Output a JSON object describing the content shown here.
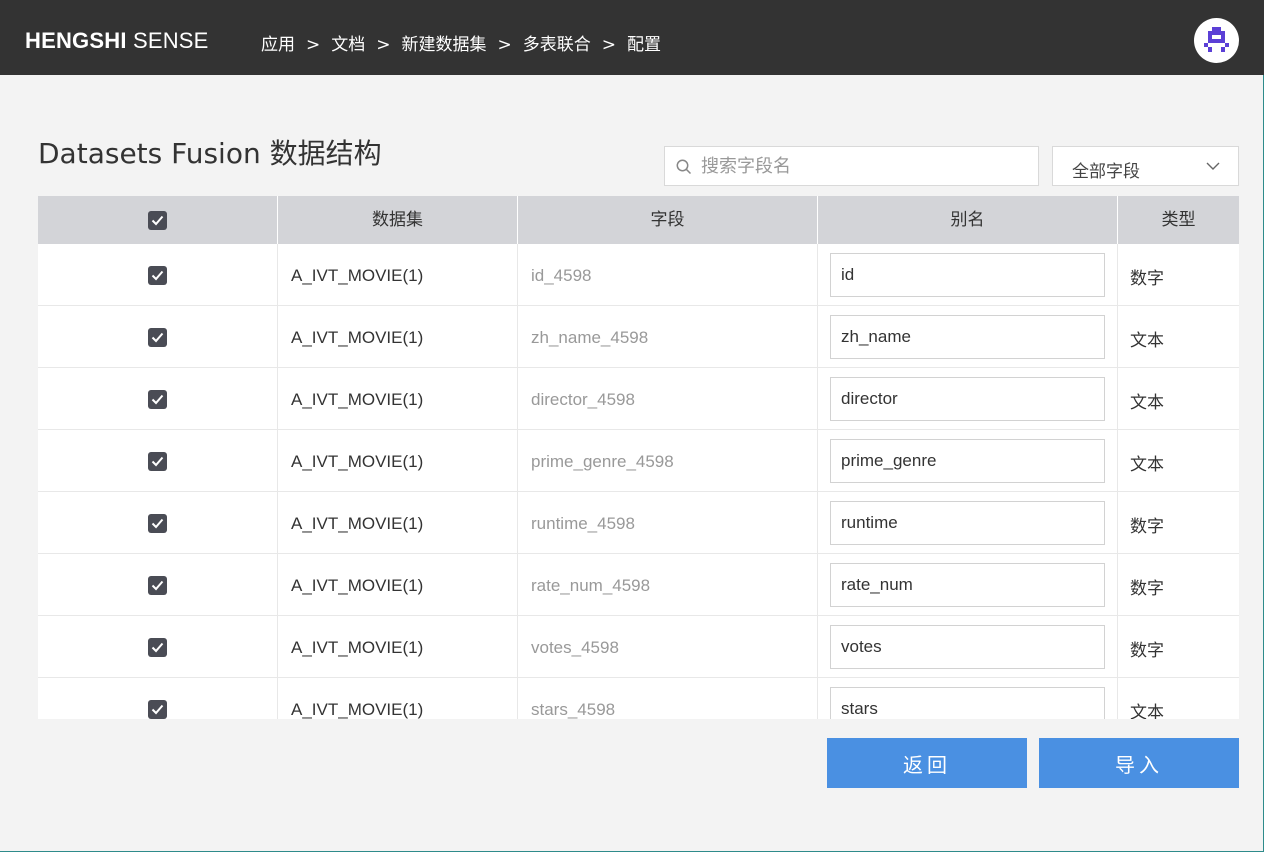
{
  "header": {
    "brand_bold": "HENGSHI",
    "brand_light": " SENSE",
    "breadcrumb": [
      "应用",
      "文档",
      "新建数据集",
      "多表联合",
      "配置"
    ],
    "separator": ">"
  },
  "page": {
    "title": "Datasets Fusion 数据结构"
  },
  "search": {
    "placeholder": "搜索字段名",
    "value": ""
  },
  "filter": {
    "selected": "全部字段"
  },
  "table": {
    "columns": [
      "数据集",
      "字段",
      "别名",
      "类型"
    ],
    "rows": [
      {
        "dataset": "A_IVT_MOVIE(1)",
        "field": "id_4598",
        "alias": "id",
        "type": "数字",
        "checked": true
      },
      {
        "dataset": "A_IVT_MOVIE(1)",
        "field": "zh_name_4598",
        "alias": "zh_name",
        "type": "文本",
        "checked": true
      },
      {
        "dataset": "A_IVT_MOVIE(1)",
        "field": "director_4598",
        "alias": "director",
        "type": "文本",
        "checked": true
      },
      {
        "dataset": "A_IVT_MOVIE(1)",
        "field": "prime_genre_4598",
        "alias": "prime_genre",
        "type": "文本",
        "checked": true
      },
      {
        "dataset": "A_IVT_MOVIE(1)",
        "field": "runtime_4598",
        "alias": "runtime",
        "type": "数字",
        "checked": true
      },
      {
        "dataset": "A_IVT_MOVIE(1)",
        "field": "rate_num_4598",
        "alias": "rate_num",
        "type": "数字",
        "checked": true
      },
      {
        "dataset": "A_IVT_MOVIE(1)",
        "field": "votes_4598",
        "alias": "votes",
        "type": "数字",
        "checked": true
      },
      {
        "dataset": "A_IVT_MOVIE(1)",
        "field": "stars_4598",
        "alias": "stars",
        "type": "文本",
        "checked": true
      }
    ]
  },
  "buttons": {
    "back": "返回",
    "import": "导入"
  },
  "colors": {
    "topbar": "#333333",
    "primary": "#4a90e2",
    "checkbox": "#4a4c55",
    "avatar_icon": "#5b3fd6"
  }
}
